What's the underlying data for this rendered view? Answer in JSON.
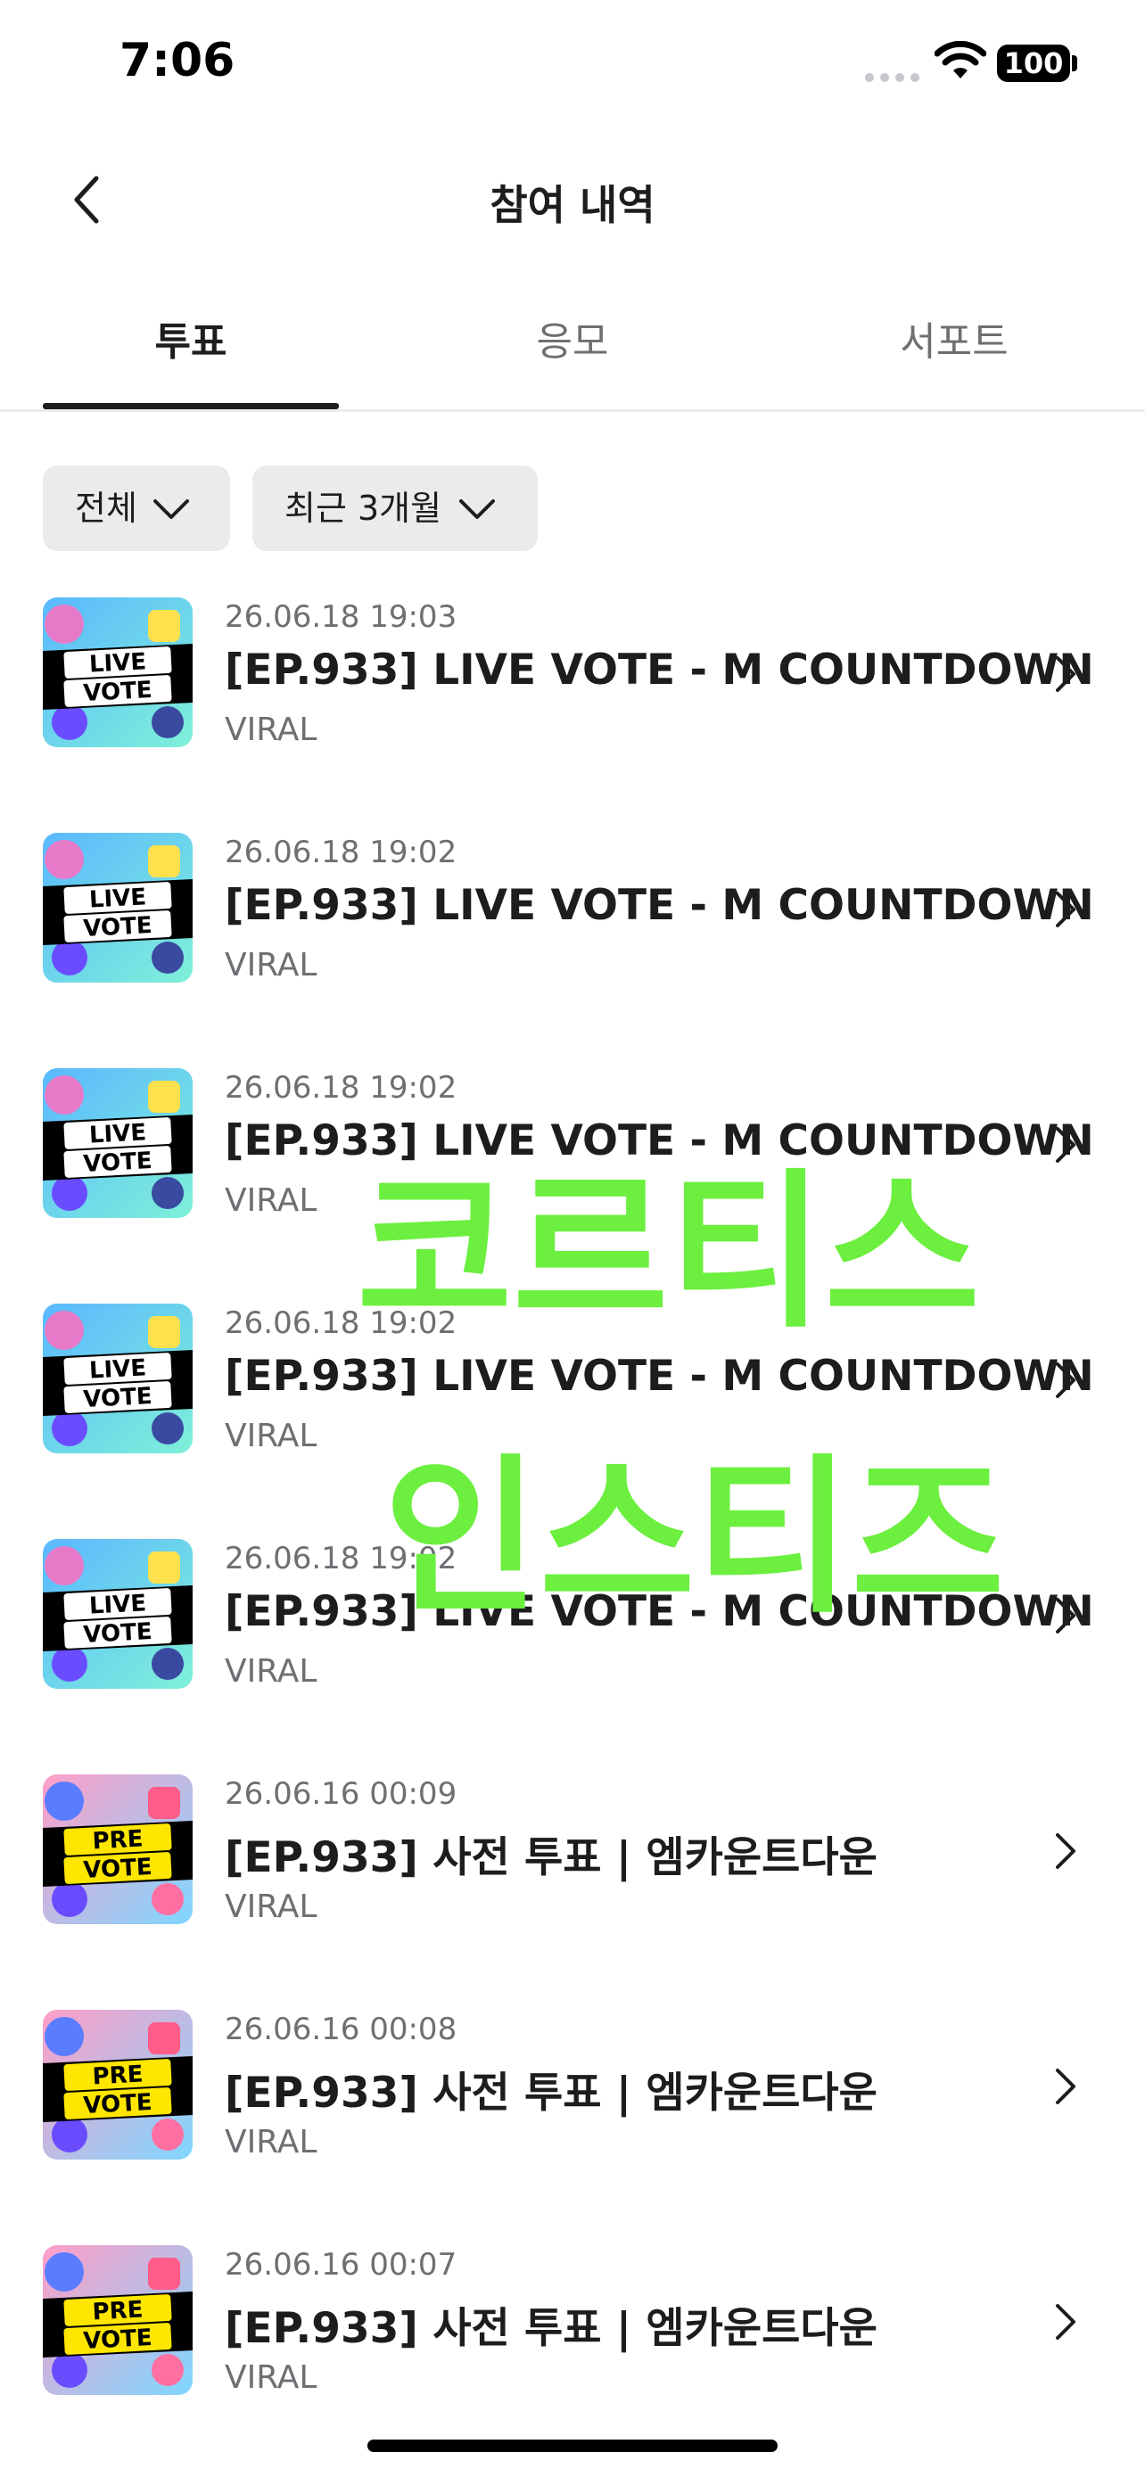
{
  "status_bar": {
    "time": "7:06",
    "battery": "100"
  },
  "header": {
    "title": "참여 내역"
  },
  "tabs": [
    {
      "label": "투표",
      "active": true
    },
    {
      "label": "응모",
      "active": false
    },
    {
      "label": "서포트",
      "active": false
    }
  ],
  "filters": [
    {
      "label": "전체"
    },
    {
      "label": "최근 3개월"
    }
  ],
  "items": [
    {
      "date": "26.06.18 19:03",
      "title": "[EP.933] LIVE VOTE - M COUNTDOWN",
      "sub": "VIRAL",
      "badge_top": "LIVE",
      "badge_bottom": "VOTE",
      "kind": "live"
    },
    {
      "date": "26.06.18 19:02",
      "title": "[EP.933] LIVE VOTE - M COUNTDOWN",
      "sub": "VIRAL",
      "badge_top": "LIVE",
      "badge_bottom": "VOTE",
      "kind": "live"
    },
    {
      "date": "26.06.18 19:02",
      "title": "[EP.933] LIVE VOTE - M COUNTDOWN",
      "sub": "VIRAL",
      "badge_top": "LIVE",
      "badge_bottom": "VOTE",
      "kind": "live"
    },
    {
      "date": "26.06.18 19:02",
      "title": "[EP.933] LIVE VOTE - M COUNTDOWN",
      "sub": "VIRAL",
      "badge_top": "LIVE",
      "badge_bottom": "VOTE",
      "kind": "live"
    },
    {
      "date": "26.06.18 19:02",
      "title": "[EP.933] LIVE VOTE - M COUNTDOWN",
      "sub": "VIRAL",
      "badge_top": "LIVE",
      "badge_bottom": "VOTE",
      "kind": "live"
    },
    {
      "date": "26.06.16 00:09",
      "title": "[EP.933] 사전 투표 | 엠카운트다운",
      "sub": "VIRAL",
      "badge_top": "PRE",
      "badge_bottom": "VOTE",
      "kind": "pre"
    },
    {
      "date": "26.06.16 00:08",
      "title": "[EP.933] 사전 투표 | 엠카운트다운",
      "sub": "VIRAL",
      "badge_top": "PRE",
      "badge_bottom": "VOTE",
      "kind": "pre"
    },
    {
      "date": "26.06.16 00:07",
      "title": "[EP.933] 사전 투표 | 엠카운트다운",
      "sub": "VIRAL",
      "badge_top": "PRE",
      "badge_bottom": "VOTE",
      "kind": "pre"
    }
  ],
  "overlay": {
    "line1": "코르티스",
    "line2": "인스티즈",
    "color": "#6cef3f"
  },
  "colors": {
    "text_primary": "#1d1d1f",
    "text_secondary": "#6e6e73",
    "filter_bg": "#ebebed"
  }
}
